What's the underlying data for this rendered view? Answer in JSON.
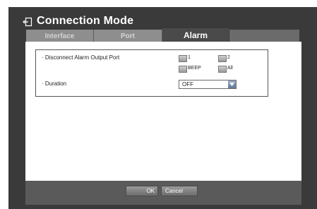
{
  "window": {
    "title": "Connection Mode"
  },
  "tabs": [
    {
      "label": "Interface",
      "active": false
    },
    {
      "label": "Port",
      "active": false
    },
    {
      "label": "Alarm",
      "active": true
    }
  ],
  "form": {
    "disconnect_alarm": {
      "label": "· Disconnect Alarm Output Port",
      "options": [
        {
          "label": "1",
          "checked": false
        },
        {
          "label": "2",
          "checked": false
        },
        {
          "label": "BEEP",
          "checked": false
        },
        {
          "label": "All",
          "checked": false
        }
      ]
    },
    "duration": {
      "label": "· Duration",
      "value": "OFF"
    }
  },
  "buttons": {
    "ok": "OK",
    "cancel": "Cancel"
  },
  "colors": {
    "screen_bg": "#3a3a3a",
    "tab_inactive": "#8e8e8e",
    "tab_active": "#4a4a4a",
    "panel_bg": "#ffffff",
    "footer_bg": "#5a5a5a",
    "dropdown_arrow": "#5f7894"
  },
  "icons": {
    "title_icon": "exit-icon",
    "dropdown_icon": "chevron-down-icon"
  }
}
